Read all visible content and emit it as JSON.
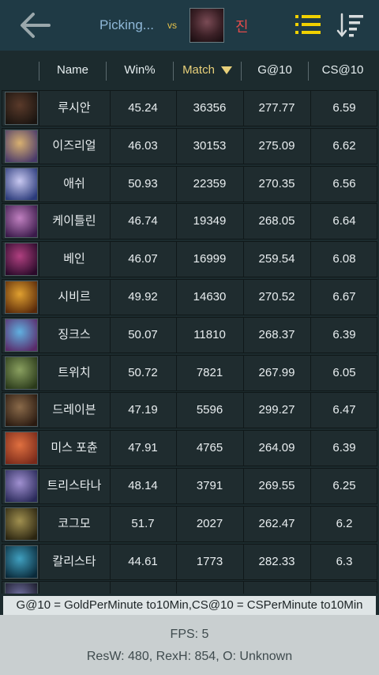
{
  "topbar": {
    "picking_text": "Picking...",
    "vs_text": "vs",
    "opponent_name": "진",
    "back_icon": "arrow-left-icon",
    "list_icon": "list-icon",
    "sort_icon": "sort-icon"
  },
  "table": {
    "headers": {
      "name": "Name",
      "win": "Win%",
      "match": "Match",
      "g10": "G@10",
      "cs10": "CS@10"
    },
    "sorted_column": "Match",
    "rows": [
      {
        "name": "루시안",
        "win": "45.24",
        "match": "36356",
        "g10": "277.77",
        "cs10": "6.59",
        "color1": "#5a3a2a",
        "color2": "#1a1410"
      },
      {
        "name": "이즈리얼",
        "win": "46.03",
        "match": "30153",
        "g10": "275.09",
        "cs10": "6.62",
        "color1": "#d8b070",
        "color2": "#4a3a6a"
      },
      {
        "name": "애쉬",
        "win": "50.93",
        "match": "22359",
        "g10": "270.35",
        "cs10": "6.56",
        "color1": "#c8c8f0",
        "color2": "#2a3a7a"
      },
      {
        "name": "케이틀린",
        "win": "46.74",
        "match": "19349",
        "g10": "268.05",
        "cs10": "6.64",
        "color1": "#c080c0",
        "color2": "#3a1a4a"
      },
      {
        "name": "베인",
        "win": "46.07",
        "match": "16999",
        "g10": "259.54",
        "cs10": "6.08",
        "color1": "#b04080",
        "color2": "#2a0a2a"
      },
      {
        "name": "시비르",
        "win": "49.92",
        "match": "14630",
        "g10": "270.52",
        "cs10": "6.67",
        "color1": "#e0a030",
        "color2": "#5a2a0a"
      },
      {
        "name": "징크스",
        "win": "50.07",
        "match": "11810",
        "g10": "268.37",
        "cs10": "6.39",
        "color1": "#60b0e0",
        "color2": "#5a2a6a"
      },
      {
        "name": "트위치",
        "win": "50.72",
        "match": "7821",
        "g10": "267.99",
        "cs10": "6.05",
        "color1": "#8aa060",
        "color2": "#2a3a1a"
      },
      {
        "name": "드레이븐",
        "win": "47.19",
        "match": "5596",
        "g10": "299.27",
        "cs10": "6.47",
        "color1": "#8a6a4a",
        "color2": "#2a1a10"
      },
      {
        "name": "미스 포츈",
        "win": "47.91",
        "match": "4765",
        "g10": "264.09",
        "cs10": "6.39",
        "color1": "#e07040",
        "color2": "#7a2a1a"
      },
      {
        "name": "트리스타나",
        "win": "48.14",
        "match": "3791",
        "g10": "269.55",
        "cs10": "6.25",
        "color1": "#a090d0",
        "color2": "#2a2a5a"
      },
      {
        "name": "코그모",
        "win": "51.7",
        "match": "2027",
        "g10": "262.47",
        "cs10": "6.2",
        "color1": "#a09050",
        "color2": "#2a2410"
      },
      {
        "name": "칼리스타",
        "win": "44.61",
        "match": "1773",
        "g10": "282.33",
        "cs10": "6.3",
        "color1": "#40a0c0",
        "color2": "#0a2a3a"
      },
      {
        "name": "",
        "win": "",
        "match": "",
        "g10": "",
        "cs10": "",
        "color1": "#7070a0",
        "color2": "#1a1a2a"
      }
    ]
  },
  "legend": "G@10 = GoldPerMinute to10Min,CS@10 = CSPerMinute to10Min",
  "footer": {
    "fps": "FPS: 5",
    "res": "ResW: 480, RexH: 854, O: Unknown"
  }
}
